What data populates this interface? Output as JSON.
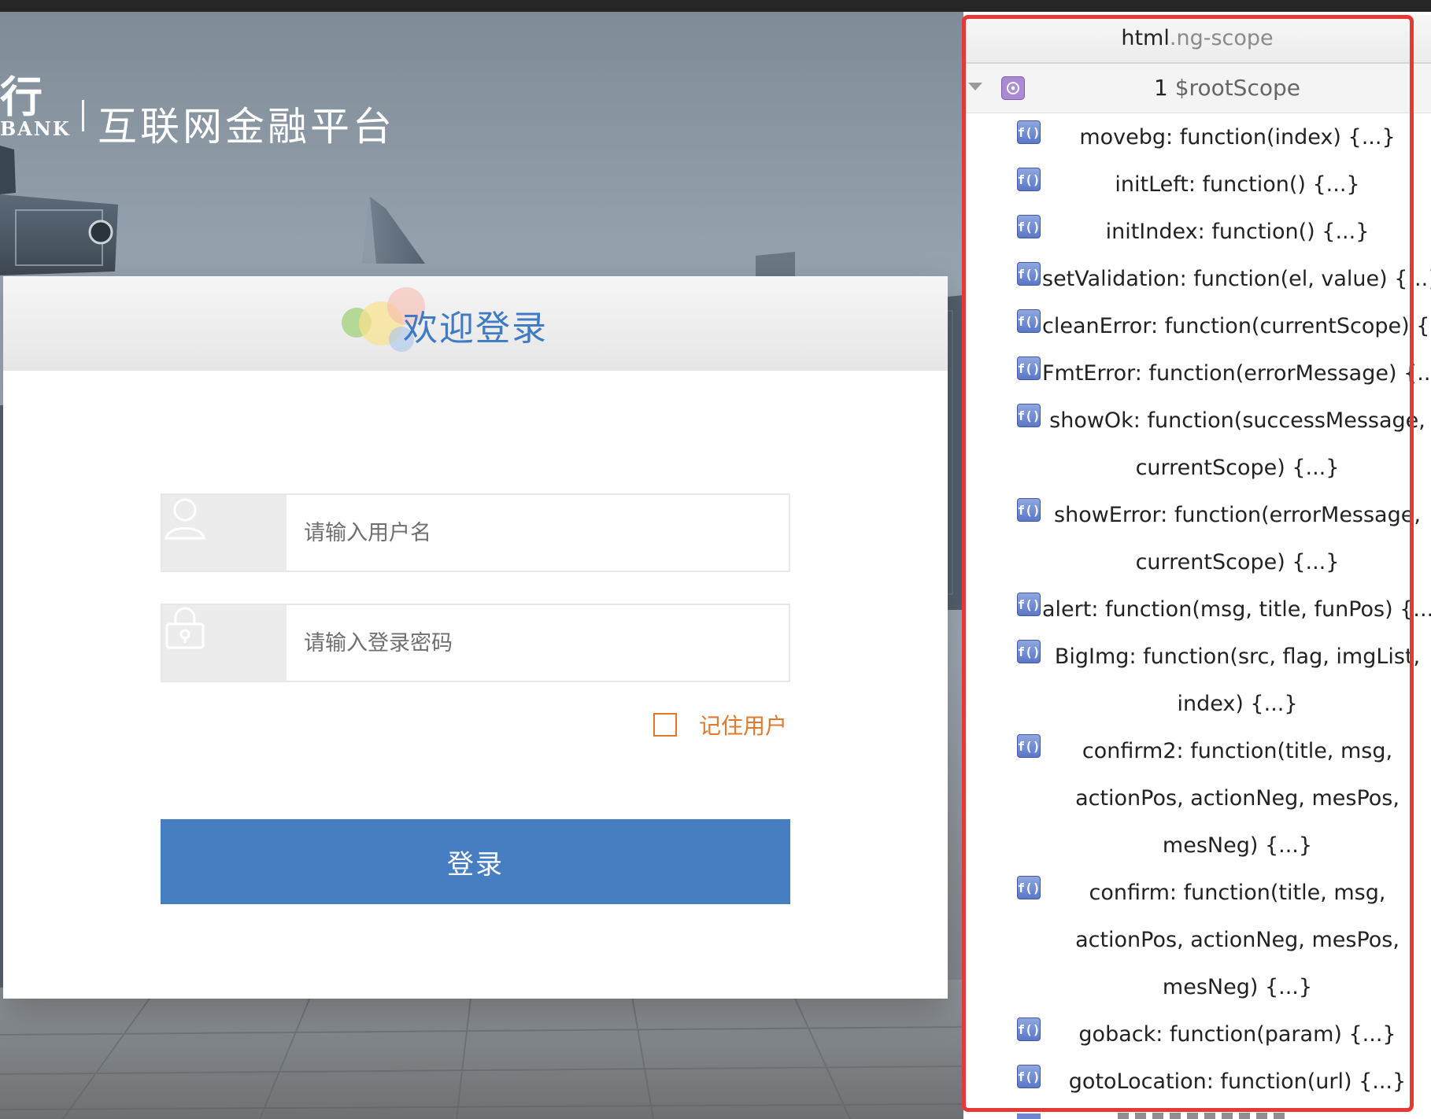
{
  "brand": {
    "logo_glyph": "行",
    "logo_latin": "BANK",
    "platform_title": "互联网金融平台"
  },
  "login": {
    "title": "欢迎登录",
    "username_placeholder": "请输入用户名",
    "password_placeholder": "请输入登录密码",
    "remember_label": "记住用户",
    "remember_checked": false,
    "submit_label": "登录"
  },
  "inspector": {
    "header_tag": "html",
    "header_class": ".ng-scope",
    "root_index": "1",
    "root_name": "$rootScope",
    "function_icon_text": "f()",
    "functions": [
      "movebg: function(index) {...}",
      "initLeft: function() {...}",
      "initIndex: function() {...}",
      "setValidation: function(el, value) {...}",
      "cleanError: function(currentScope) {...}",
      "FmtError: function(errorMessage) {...}",
      "showOk: function(successMessage,\ncurrentScope) {...}",
      "showError: function(errorMessage,\ncurrentScope) {...}",
      "alert: function(msg, title, funPos) {...}",
      "BigImg: function(src, flag, imgList,\nindex) {...}",
      "confirm2: function(title, msg,\nactionPos, actionNeg, mesPos,\nmesNeg) {...}",
      "confirm: function(title, msg,\nactionPos, actionNeg, mesPos,\nmesNeg) {...}",
      "goback: function(param) {...}",
      "gotoLocation: function(url) {...}"
    ]
  },
  "colors": {
    "accent_blue": "#477dc1",
    "title_blue": "#3f7ac5",
    "remember_orange": "#e07a2f",
    "highlight_red": "#e53935"
  }
}
